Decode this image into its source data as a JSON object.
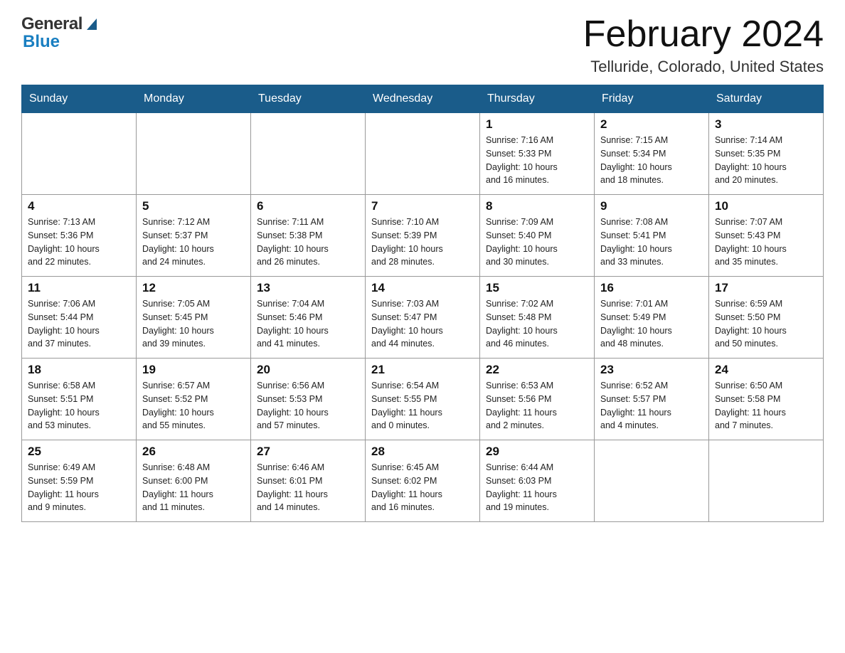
{
  "header": {
    "logo_general": "General",
    "logo_blue": "Blue",
    "month_title": "February 2024",
    "location": "Telluride, Colorado, United States"
  },
  "weekdays": [
    "Sunday",
    "Monday",
    "Tuesday",
    "Wednesday",
    "Thursday",
    "Friday",
    "Saturday"
  ],
  "weeks": [
    [
      {
        "day": "",
        "info": ""
      },
      {
        "day": "",
        "info": ""
      },
      {
        "day": "",
        "info": ""
      },
      {
        "day": "",
        "info": ""
      },
      {
        "day": "1",
        "info": "Sunrise: 7:16 AM\nSunset: 5:33 PM\nDaylight: 10 hours\nand 16 minutes."
      },
      {
        "day": "2",
        "info": "Sunrise: 7:15 AM\nSunset: 5:34 PM\nDaylight: 10 hours\nand 18 minutes."
      },
      {
        "day": "3",
        "info": "Sunrise: 7:14 AM\nSunset: 5:35 PM\nDaylight: 10 hours\nand 20 minutes."
      }
    ],
    [
      {
        "day": "4",
        "info": "Sunrise: 7:13 AM\nSunset: 5:36 PM\nDaylight: 10 hours\nand 22 minutes."
      },
      {
        "day": "5",
        "info": "Sunrise: 7:12 AM\nSunset: 5:37 PM\nDaylight: 10 hours\nand 24 minutes."
      },
      {
        "day": "6",
        "info": "Sunrise: 7:11 AM\nSunset: 5:38 PM\nDaylight: 10 hours\nand 26 minutes."
      },
      {
        "day": "7",
        "info": "Sunrise: 7:10 AM\nSunset: 5:39 PM\nDaylight: 10 hours\nand 28 minutes."
      },
      {
        "day": "8",
        "info": "Sunrise: 7:09 AM\nSunset: 5:40 PM\nDaylight: 10 hours\nand 30 minutes."
      },
      {
        "day": "9",
        "info": "Sunrise: 7:08 AM\nSunset: 5:41 PM\nDaylight: 10 hours\nand 33 minutes."
      },
      {
        "day": "10",
        "info": "Sunrise: 7:07 AM\nSunset: 5:43 PM\nDaylight: 10 hours\nand 35 minutes."
      }
    ],
    [
      {
        "day": "11",
        "info": "Sunrise: 7:06 AM\nSunset: 5:44 PM\nDaylight: 10 hours\nand 37 minutes."
      },
      {
        "day": "12",
        "info": "Sunrise: 7:05 AM\nSunset: 5:45 PM\nDaylight: 10 hours\nand 39 minutes."
      },
      {
        "day": "13",
        "info": "Sunrise: 7:04 AM\nSunset: 5:46 PM\nDaylight: 10 hours\nand 41 minutes."
      },
      {
        "day": "14",
        "info": "Sunrise: 7:03 AM\nSunset: 5:47 PM\nDaylight: 10 hours\nand 44 minutes."
      },
      {
        "day": "15",
        "info": "Sunrise: 7:02 AM\nSunset: 5:48 PM\nDaylight: 10 hours\nand 46 minutes."
      },
      {
        "day": "16",
        "info": "Sunrise: 7:01 AM\nSunset: 5:49 PM\nDaylight: 10 hours\nand 48 minutes."
      },
      {
        "day": "17",
        "info": "Sunrise: 6:59 AM\nSunset: 5:50 PM\nDaylight: 10 hours\nand 50 minutes."
      }
    ],
    [
      {
        "day": "18",
        "info": "Sunrise: 6:58 AM\nSunset: 5:51 PM\nDaylight: 10 hours\nand 53 minutes."
      },
      {
        "day": "19",
        "info": "Sunrise: 6:57 AM\nSunset: 5:52 PM\nDaylight: 10 hours\nand 55 minutes."
      },
      {
        "day": "20",
        "info": "Sunrise: 6:56 AM\nSunset: 5:53 PM\nDaylight: 10 hours\nand 57 minutes."
      },
      {
        "day": "21",
        "info": "Sunrise: 6:54 AM\nSunset: 5:55 PM\nDaylight: 11 hours\nand 0 minutes."
      },
      {
        "day": "22",
        "info": "Sunrise: 6:53 AM\nSunset: 5:56 PM\nDaylight: 11 hours\nand 2 minutes."
      },
      {
        "day": "23",
        "info": "Sunrise: 6:52 AM\nSunset: 5:57 PM\nDaylight: 11 hours\nand 4 minutes."
      },
      {
        "day": "24",
        "info": "Sunrise: 6:50 AM\nSunset: 5:58 PM\nDaylight: 11 hours\nand 7 minutes."
      }
    ],
    [
      {
        "day": "25",
        "info": "Sunrise: 6:49 AM\nSunset: 5:59 PM\nDaylight: 11 hours\nand 9 minutes."
      },
      {
        "day": "26",
        "info": "Sunrise: 6:48 AM\nSunset: 6:00 PM\nDaylight: 11 hours\nand 11 minutes."
      },
      {
        "day": "27",
        "info": "Sunrise: 6:46 AM\nSunset: 6:01 PM\nDaylight: 11 hours\nand 14 minutes."
      },
      {
        "day": "28",
        "info": "Sunrise: 6:45 AM\nSunset: 6:02 PM\nDaylight: 11 hours\nand 16 minutes."
      },
      {
        "day": "29",
        "info": "Sunrise: 6:44 AM\nSunset: 6:03 PM\nDaylight: 11 hours\nand 19 minutes."
      },
      {
        "day": "",
        "info": ""
      },
      {
        "day": "",
        "info": ""
      }
    ]
  ]
}
